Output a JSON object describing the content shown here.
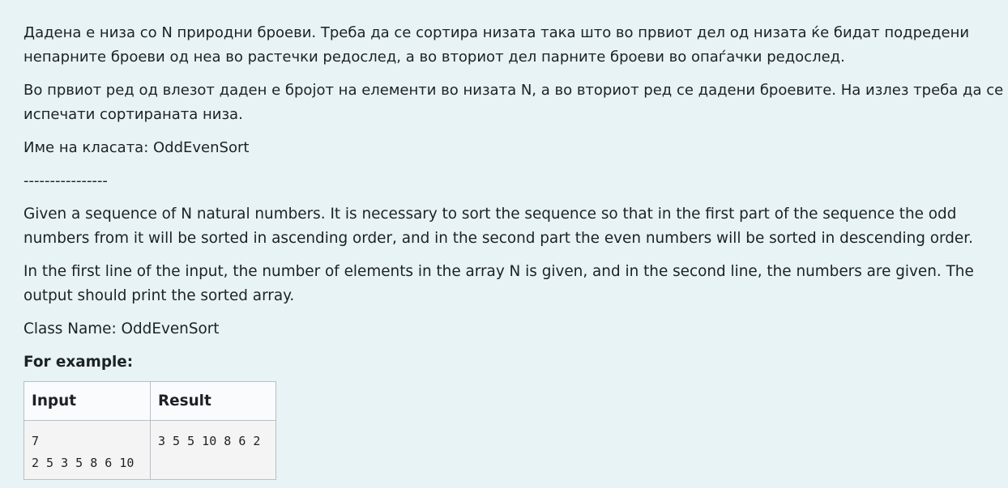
{
  "description": {
    "mk_paragraph_1": "Дадена е низа со N природни броеви. Треба да се сортира низата така што во првиот дел од низата ќе бидат подредени непарните броеви од неа во растечки редослед, а во вториот дел парните броеви во опаѓачки редослед.",
    "mk_paragraph_2": "Во првиот ред од влезот даден е бројот на елементи во низата N, а во вториот ред се дадени броевите. На излез треба да се испечати сортираната низа.",
    "mk_class_name": "Име на класата: OddEvenSort",
    "separator": "----------------",
    "en_paragraph_1": "Given a sequence of N natural numbers. It is necessary to sort the sequence so that in the first part of the sequence the odd numbers from it will be sorted in ascending order, and in the second part the even numbers will be sorted in descending order.",
    "en_paragraph_2": "In the first line of the input, the number of elements in the array N is given, and in the second line, the numbers are given. The output should print the sorted array.",
    "en_class_name": "Class Name: OddEvenSort"
  },
  "example": {
    "heading": "For example:",
    "headers": {
      "input": "Input",
      "result": "Result"
    },
    "rows": [
      {
        "input": "7\n2 5 3 5 8 6 10",
        "result": "3 5 5 10 8 6 2"
      }
    ]
  }
}
